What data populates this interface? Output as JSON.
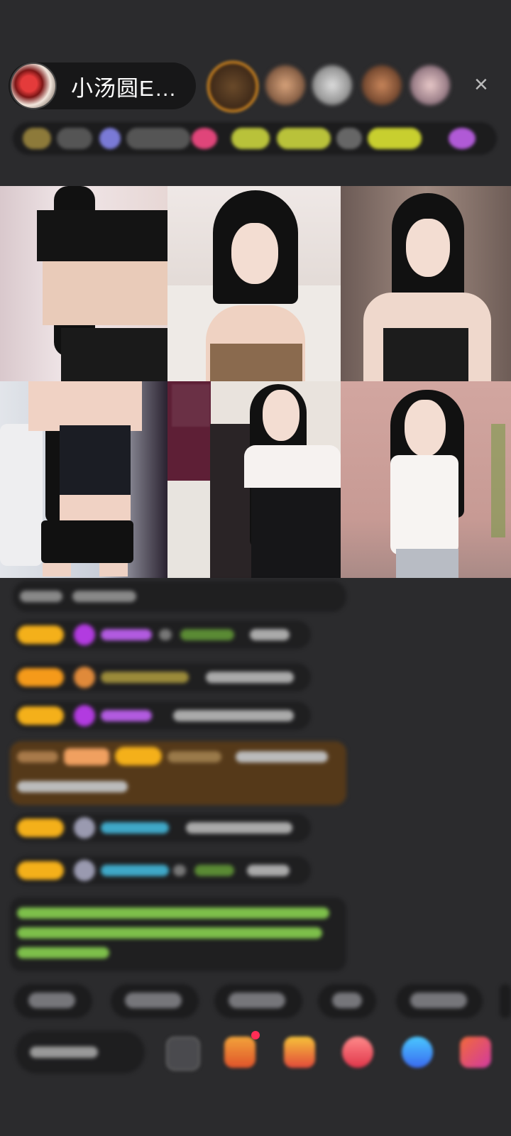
{
  "host": {
    "name": "小汤圆E…"
  },
  "header": {
    "close_glyph": "×",
    "viewers": [
      "viewer-avatar-1",
      "viewer-avatar-2",
      "viewer-avatar-3",
      "viewer-avatar-4",
      "viewer-avatar-5"
    ]
  },
  "colors": {
    "background": "#2b2b2d",
    "badge": "#f4b01a",
    "chat_green": "#7dbf4a",
    "chat_cyan": "#3fa8c8",
    "chat_purple": "#b25be0"
  },
  "video_tiles": [
    {
      "id": "streamer-1",
      "overlay": ""
    },
    {
      "id": "streamer-2",
      "overlay": ""
    },
    {
      "id": "streamer-3",
      "overlay": ""
    },
    {
      "id": "streamer-4",
      "overlay": ""
    },
    {
      "id": "streamer-5",
      "overlay": ""
    },
    {
      "id": "streamer-6",
      "overlay": ""
    }
  ]
}
